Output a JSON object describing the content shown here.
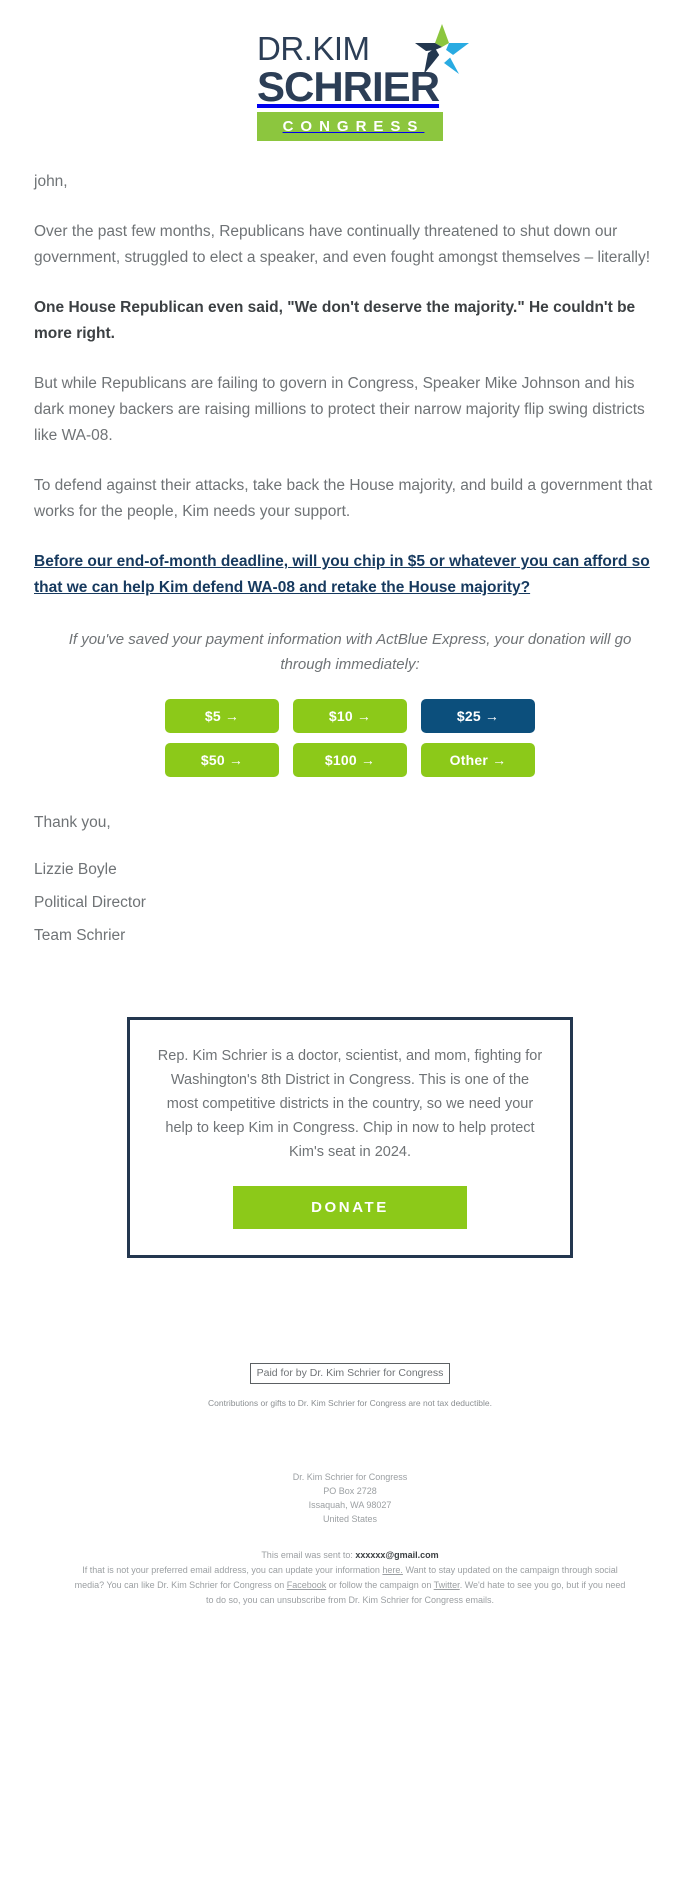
{
  "colors": {
    "green": "#8cc919",
    "logo_green": "#8cc63e",
    "navy": "#23374f",
    "deep_blue": "#0c4f7c",
    "cyan": "#29abe2",
    "body_text": "#6f7376"
  },
  "header": {
    "logo_line1": "DR.KIM",
    "logo_line2": "SCHRIER",
    "logo_bar": "CONGRESS",
    "star_icon": "star-icon"
  },
  "body": {
    "greeting": "john,",
    "p1": "Over the past few months, Republicans have continually threatened to shut down our government, struggled to elect a speaker, and even fought amongst themselves – literally!",
    "p2_bold": "One House Republican even said, \"We don't deserve the majority.\" He couldn't be more right.",
    "p3": "But while Republicans are failing to govern in Congress, Speaker Mike Johnson and his dark money backers are raising millions to protect their narrow majority flip swing districts like WA-08.",
    "p4": "To defend against their attacks, take back the House majority, and build a government that works for the people, Kim needs your support.",
    "cta_link": "Before our end-of-month deadline, will you chip in $5 or whatever you can afford so that we can help Kim defend WA-08 and retake the House majority?",
    "express_note": "If you've saved your payment information with ActBlue Express, your donation will go through immediately:",
    "signoff": "Thank you,",
    "signature_line1": "Lizzie Boyle",
    "signature_line2": "Political Director",
    "signature_line3": "Team Schrier"
  },
  "ask_buttons": [
    {
      "label": "$5 →",
      "style": "green"
    },
    {
      "label": "$10 →",
      "style": "green"
    },
    {
      "label": "$25 →",
      "style": "navy"
    },
    {
      "label": "$50 →",
      "style": "green"
    },
    {
      "label": "$100 →",
      "style": "green"
    },
    {
      "label": "Other →",
      "style": "green"
    }
  ],
  "callout": {
    "text": "Rep. Kim Schrier is a doctor, scientist, and mom, fighting for Washington's 8th District in Congress. This is one of the most competitive districts in the country, so we need your help to keep Kim in Congress. Chip in now to help protect Kim's seat in 2024.",
    "donate_label": "DONATE"
  },
  "footer": {
    "paid_for": "Paid for by Dr. Kim Schrier for Congress",
    "tax_note": "Contributions or gifts to Dr. Kim Schrier for Congress are not tax deductible.",
    "address_line1": "Dr. Kim Schrier for Congress",
    "address_line2": "PO Box 2728",
    "address_line3": "Issaquah, WA 98027",
    "address_line4": "United States",
    "sent_to_prefix": "This email was sent to: ",
    "sent_to_email": "xxxxxx@gmail.com",
    "unsub_1": "If that is not your preferred email address, you can update your information ",
    "unsub_link_here": "here.",
    "unsub_2": " Want to stay updated on the campaign through social media? You can like Dr. Kim Schrier for Congress on ",
    "unsub_link_fb": "Facebook",
    "unsub_3": " or follow the campaign on ",
    "unsub_link_tw": "Twitter",
    "unsub_4": ". We'd hate to see you go, but if you need to do so, you can unsubscribe from Dr. Kim Schrier for Congress emails."
  }
}
